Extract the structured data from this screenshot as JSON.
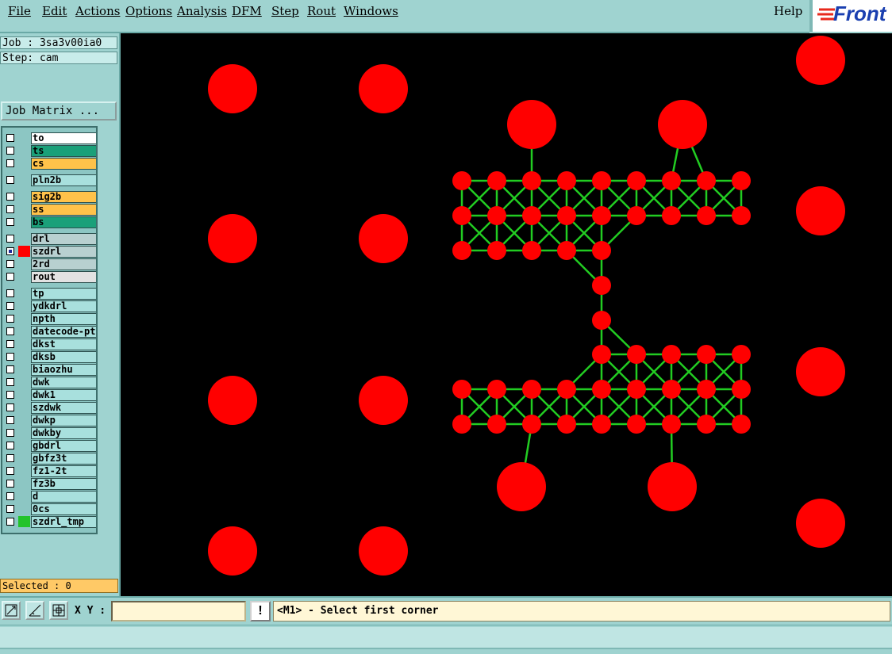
{
  "menu": {
    "file": "File",
    "edit": "Edit",
    "actions": "Actions",
    "options": "Options",
    "analysis": "Analysis",
    "dfm": "DFM",
    "step": "Step",
    "rout": "Rout",
    "windows": "Windows",
    "help": "Help"
  },
  "brand": {
    "logo_text": "Front"
  },
  "job": {
    "label": "Job : 3sa3v00ia0",
    "step": "Step: cam"
  },
  "job_matrix_button": "Job Matrix ...",
  "layers": [
    {
      "name": "to",
      "color": "#ffffff",
      "swatch": "",
      "checked": false
    },
    {
      "name": "ts",
      "color": "#1aa079",
      "swatch": "",
      "checked": false
    },
    {
      "name": "cs",
      "color": "#ffc24a",
      "swatch": "",
      "checked": false
    },
    {
      "name": "pln2b",
      "color": "#a8e0dd",
      "swatch": "",
      "checked": false
    },
    {
      "name": "sig2b",
      "color": "#ffc24a",
      "swatch": "",
      "checked": false
    },
    {
      "name": "ss",
      "color": "#ffc24a",
      "swatch": "",
      "checked": false
    },
    {
      "name": "bs",
      "color": "#1aa079",
      "swatch": "",
      "checked": false
    },
    {
      "name": "drl",
      "color": "#b8d0d0",
      "swatch": "",
      "checked": false
    },
    {
      "name": "szdrl",
      "color": "#b8d0d0",
      "swatch": "#ff0000",
      "checked": true
    },
    {
      "name": "2rd",
      "color": "#b8d0d0",
      "swatch": "",
      "checked": false
    },
    {
      "name": "rout",
      "color": "#e2e2e2",
      "swatch": "",
      "checked": false
    },
    {
      "name": "tp",
      "color": "#a8e0dd",
      "swatch": "",
      "checked": false
    },
    {
      "name": "ydkdrl",
      "color": "#a8e0dd",
      "swatch": "",
      "checked": false
    },
    {
      "name": "npth",
      "color": "#a8e0dd",
      "swatch": "",
      "checked": false
    },
    {
      "name": "datecode-pte",
      "color": "#a8e0dd",
      "swatch": "",
      "checked": false
    },
    {
      "name": "dkst",
      "color": "#a8e0dd",
      "swatch": "",
      "checked": false
    },
    {
      "name": "dksb",
      "color": "#a8e0dd",
      "swatch": "",
      "checked": false
    },
    {
      "name": "biaozhu",
      "color": "#a8e0dd",
      "swatch": "",
      "checked": false
    },
    {
      "name": "dwk",
      "color": "#a8e0dd",
      "swatch": "",
      "checked": false
    },
    {
      "name": "dwk1",
      "color": "#a8e0dd",
      "swatch": "",
      "checked": false
    },
    {
      "name": "szdwk",
      "color": "#a8e0dd",
      "swatch": "",
      "checked": false
    },
    {
      "name": "dwkp",
      "color": "#a8e0dd",
      "swatch": "",
      "checked": false
    },
    {
      "name": "dwkby",
      "color": "#a8e0dd",
      "swatch": "",
      "checked": false
    },
    {
      "name": "gbdrl",
      "color": "#a8e0dd",
      "swatch": "",
      "checked": false
    },
    {
      "name": "gbfz3t",
      "color": "#a8e0dd",
      "swatch": "",
      "checked": false
    },
    {
      "name": "fz1-2t",
      "color": "#a8e0dd",
      "swatch": "",
      "checked": false
    },
    {
      "name": "fz3b",
      "color": "#a8e0dd",
      "swatch": "",
      "checked": false
    },
    {
      "name": "d",
      "color": "#a8e0dd",
      "swatch": "",
      "checked": false
    },
    {
      "name": "0cs",
      "color": "#a8e0dd",
      "swatch": "",
      "checked": false
    },
    {
      "name": "szdrl_tmp",
      "color": "#a8e0dd",
      "swatch": "#22c32a",
      "checked": false
    }
  ],
  "selected_text": "Selected : 0",
  "coords": {
    "label": "X Y :",
    "value": ""
  },
  "prompt": "<M1> - Select first corner",
  "colors": {
    "pad": "#ff0000",
    "trace": "#22cc22",
    "canvas": "#000000",
    "panel": "#9fd3d0"
  },
  "icons": [
    "zoom-fit-icon",
    "measure-icon",
    "grid-snap-icon",
    "exclamation-icon"
  ]
}
